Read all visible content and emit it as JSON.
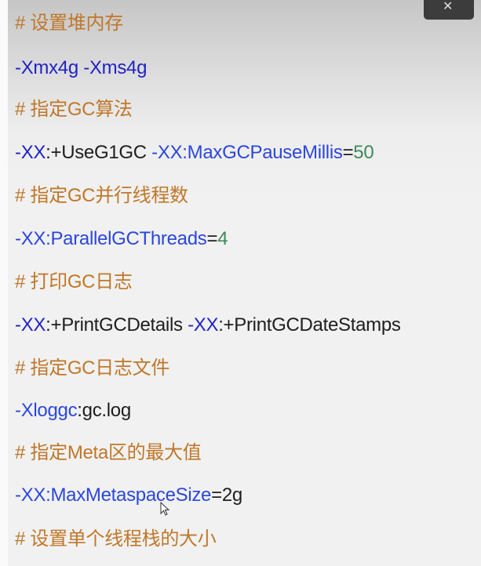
{
  "colors": {
    "comment": "#c0772a",
    "flag": "#2222c4",
    "option": "#2b47dd",
    "plain": "#1e1e1e",
    "number": "#3a8a5c"
  },
  "lines": [
    {
      "segments": [
        {
          "text": "# 设置堆内存",
          "type": "comment"
        }
      ]
    },
    {
      "segments": [
        {
          "text": "-Xmx4g -Xms4g",
          "type": "flag"
        }
      ]
    },
    {
      "segments": [
        {
          "text": "# 指定GC算法",
          "type": "comment"
        }
      ]
    },
    {
      "segments": [
        {
          "text": "-XX",
          "type": "flag"
        },
        {
          "text": ":+UseG1GC ",
          "type": "plain"
        },
        {
          "text": "-XX:MaxGCPauseMillis",
          "type": "option"
        },
        {
          "text": "=",
          "type": "plain"
        },
        {
          "text": "50",
          "type": "number"
        }
      ]
    },
    {
      "segments": [
        {
          "text": "# 指定GC并行线程数",
          "type": "comment"
        }
      ]
    },
    {
      "segments": [
        {
          "text": "-XX:ParallelGCThreads",
          "type": "option"
        },
        {
          "text": "=",
          "type": "plain"
        },
        {
          "text": "4",
          "type": "number"
        }
      ]
    },
    {
      "segments": [
        {
          "text": "# 打印GC日志",
          "type": "comment"
        }
      ]
    },
    {
      "segments": [
        {
          "text": "-XX",
          "type": "flag"
        },
        {
          "text": ":+PrintGCDetails ",
          "type": "plain"
        },
        {
          "text": "-XX",
          "type": "flag"
        },
        {
          "text": ":+PrintGCDateStamps",
          "type": "plain"
        }
      ]
    },
    {
      "segments": [
        {
          "text": "# 指定GC日志文件",
          "type": "comment"
        }
      ]
    },
    {
      "segments": [
        {
          "text": "-Xloggc",
          "type": "option"
        },
        {
          "text": ":gc.log",
          "type": "plain"
        }
      ]
    },
    {
      "segments": [
        {
          "text": "# 指定Meta区的最大值",
          "type": "comment"
        }
      ]
    },
    {
      "segments": [
        {
          "text": "-XX:MaxMetaspaceSize",
          "type": "option"
        },
        {
          "text": "=2g",
          "type": "plain"
        }
      ]
    },
    {
      "segments": [
        {
          "text": "# 设置单个线程栈的大小",
          "type": "comment"
        }
      ]
    }
  ],
  "top_button": {
    "icon": "collapse-icon"
  }
}
